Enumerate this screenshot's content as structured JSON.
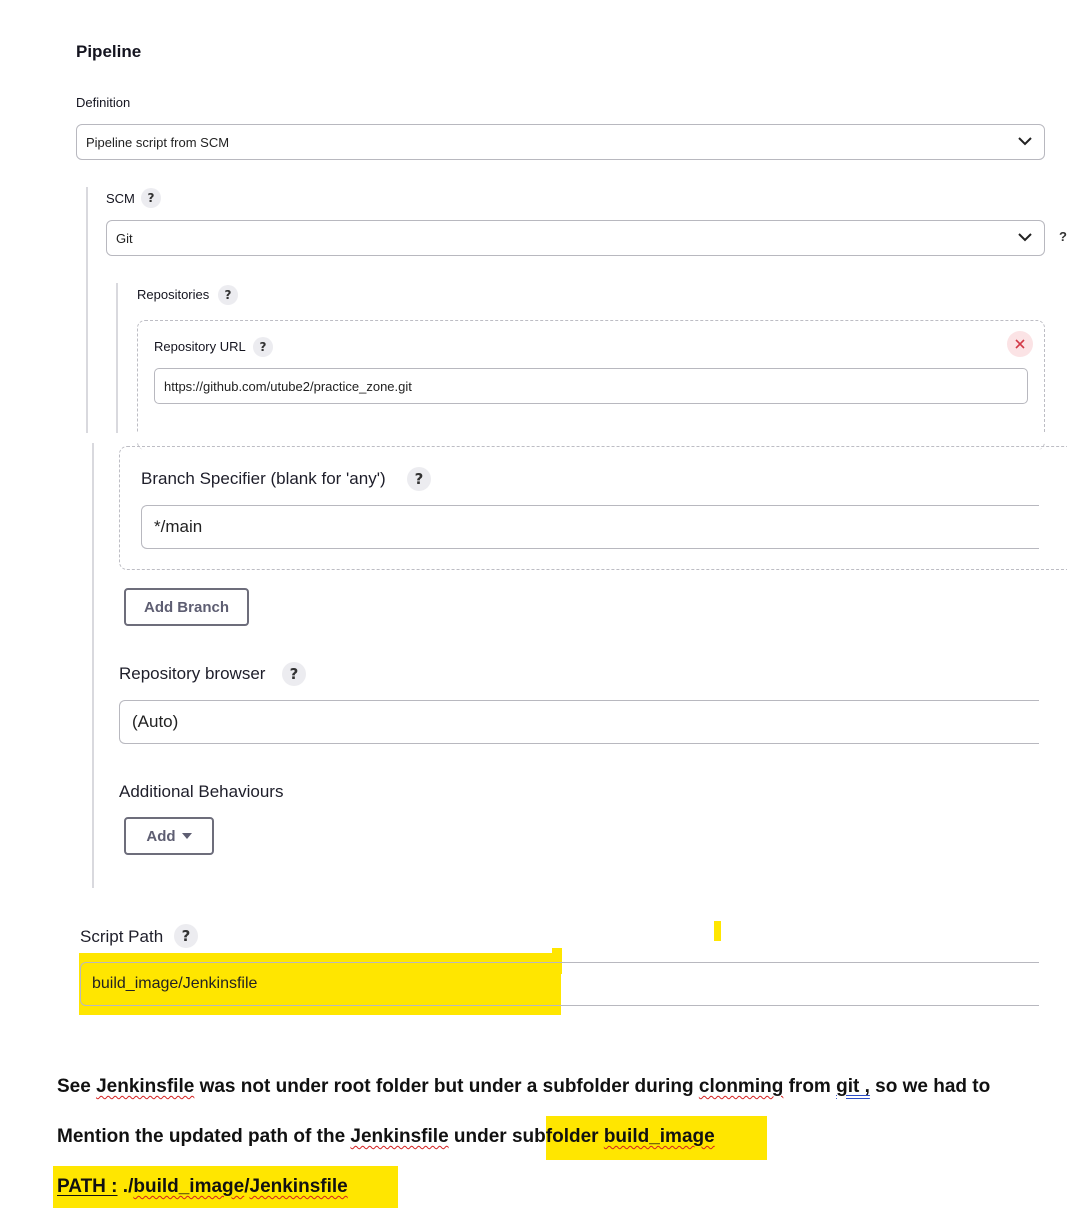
{
  "pipeline": {
    "section_title": "Pipeline",
    "definition_label": "Definition",
    "definition_value": "Pipeline script from SCM"
  },
  "scm": {
    "label": "SCM",
    "value": "Git",
    "help": "?"
  },
  "repositories": {
    "label": "Repositories",
    "help": "?",
    "url_label": "Repository URL",
    "url_value": "https://github.com/utube2/practice_zone.git",
    "remove_icon": "close-icon"
  },
  "branch": {
    "label": "Branch Specifier (blank for 'any')",
    "value": "*/main",
    "help": "?",
    "add_label": "Add Branch"
  },
  "browser": {
    "label": "Repository browser",
    "value": "(Auto)",
    "help": "?"
  },
  "behaviours": {
    "label": "Additional Behaviours",
    "add_label": "Add"
  },
  "script_path": {
    "label": "Script Path",
    "value": "build_image/Jenkinsfile",
    "help": "?"
  },
  "annotation": {
    "line1_a": "See ",
    "line1_b": "Jenkinsfile",
    "line1_c": " was not under root folder but under a subfolder during ",
    "line1_d": "clonming",
    "line1_e": " from ",
    "line1_f": "git ,",
    "line1_g": " so we had to",
    "line2_a": "Mention the updated path of the ",
    "line2_b": "Jenkinsfile",
    "line2_c": " under ",
    "line2_d": "subfolder ",
    "line2_e": "build_image",
    "line3_a": "PATH :",
    "line3_b": " ./",
    "line3_c": "build_image",
    "line3_d": "/",
    "line3_e": "Jenkinsfile"
  },
  "colors": {
    "highlight": "#ffe600",
    "spellcheck": "#d42020",
    "close": "#d23a48"
  }
}
